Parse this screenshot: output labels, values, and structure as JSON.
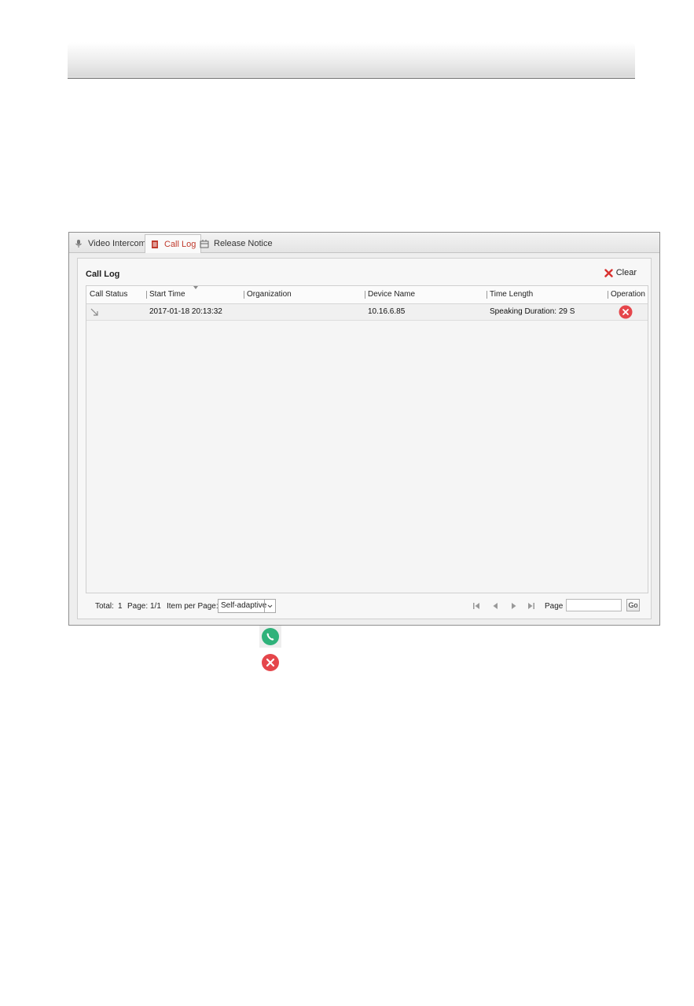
{
  "tabs": [
    {
      "label": "Video Intercom",
      "icon": "microphone-icon",
      "active": false
    },
    {
      "label": "Call Log",
      "icon": "document-icon",
      "active": true
    },
    {
      "label": "Release Notice",
      "icon": "notice-board-icon",
      "active": false
    }
  ],
  "panel": {
    "title": "Call Log",
    "clear_label": "Clear"
  },
  "table": {
    "columns": [
      "Call Status",
      "Start Time",
      "Organization",
      "Device Name",
      "Time Length",
      "Operation"
    ],
    "rows": [
      {
        "status_icon": "outgoing-call-arrow-icon",
        "start_time": "2017-01-18 20:13:32",
        "organization": "",
        "device_name": "10.16.6.85",
        "time_length": "Speaking Duration: 29 S",
        "operation_icon": "delete-icon"
      }
    ]
  },
  "footer": {
    "total_label": "Total:",
    "total_value": "1",
    "page_label": "Page:",
    "page_value": "1/1",
    "items_label": "Item per Page:",
    "items_value": "Self-adaptive",
    "goto_label": "Page",
    "goto_value": "",
    "go_label": "Go"
  },
  "legend_icons": [
    "answer-call-icon",
    "hang-up-icon"
  ],
  "colors": {
    "active_tab": "#c0392b",
    "delete_red": "#e5464b",
    "answer_green": "#2fb27a"
  }
}
